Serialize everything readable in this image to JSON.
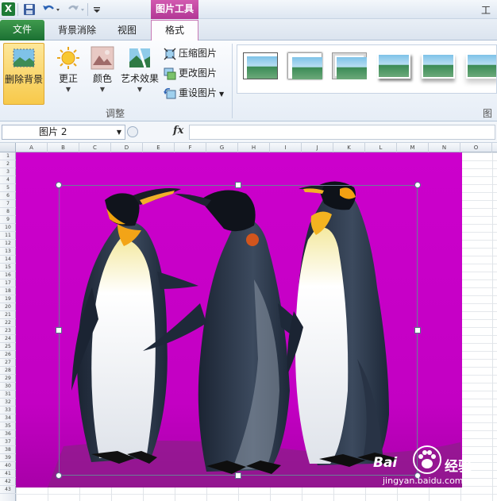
{
  "title_bar": {
    "context_tool_label": "图片工具",
    "title_text": "工作",
    "app_icon_text": "X"
  },
  "tabs": {
    "file": "文件",
    "background_removal": "背景消除",
    "view": "视图",
    "format": "格式"
  },
  "ribbon": {
    "remove_background": "删除背景",
    "corrections": "更正",
    "color": "颜色",
    "artistic_effects": "艺术效果",
    "compress_pictures": "压缩图片",
    "change_picture": "更改图片",
    "reset_picture": "重设图片",
    "adjust_group_label": "调整",
    "styles_group_label": "图"
  },
  "formula_bar": {
    "name_box_value": "图片 2",
    "fx_label": "fx",
    "formula_value": ""
  },
  "grid": {
    "columns": [
      "A",
      "B",
      "C",
      "D",
      "E",
      "F",
      "G",
      "H",
      "I",
      "J",
      "K",
      "L",
      "M",
      "N",
      "O"
    ],
    "rows": [
      "1",
      "2",
      "3",
      "4",
      "5",
      "6",
      "7",
      "8",
      "9",
      "10",
      "11",
      "12",
      "13",
      "14",
      "15",
      "16",
      "17",
      "18",
      "19",
      "20",
      "21",
      "22",
      "23",
      "24",
      "25",
      "26",
      "27",
      "28",
      "29",
      "30",
      "31",
      "32",
      "33",
      "34",
      "35",
      "36",
      "37",
      "38",
      "39",
      "40",
      "41",
      "42",
      "43"
    ]
  },
  "watermark": {
    "brand": "Bai",
    "brand_suffix": "经验",
    "url": "jingyan.baidu.com"
  },
  "colors": {
    "removed_background": "#c800c8",
    "file_tab": "#2a8640",
    "context_tab": "#c54aa3",
    "active_button": "#f7c94a"
  }
}
